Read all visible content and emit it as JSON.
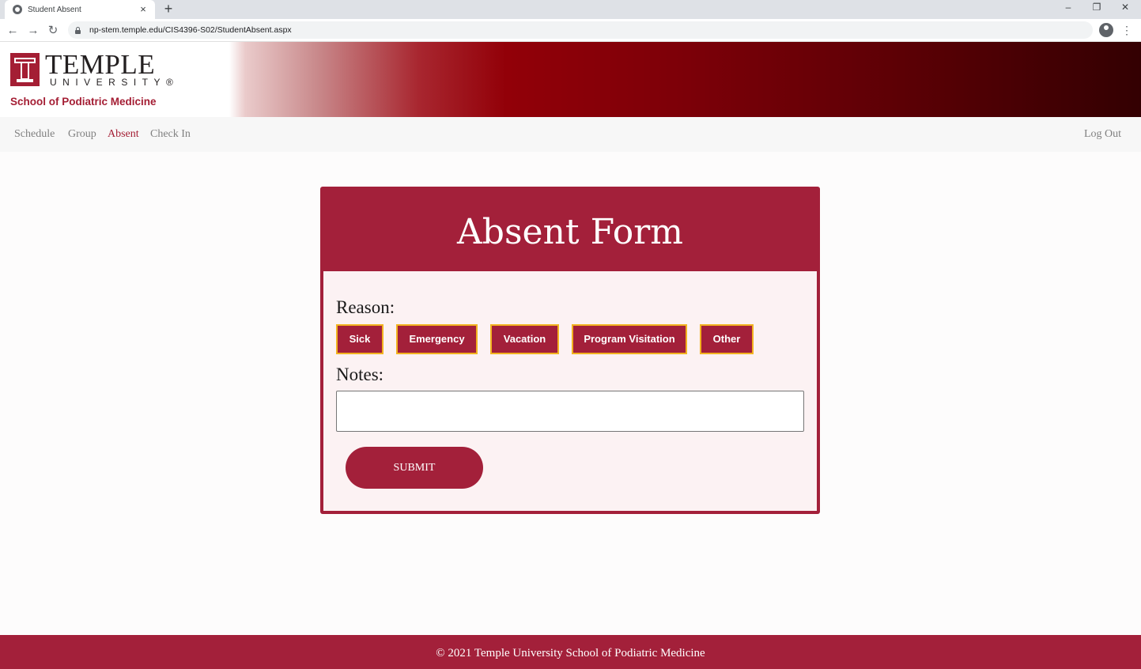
{
  "browser": {
    "tab_title": "Student Absent",
    "tab_close": "×",
    "new_tab": "+",
    "url": "np-stem.temple.edu/CIS4396-S02/StudentAbsent.aspx",
    "window_controls": {
      "minimize": "–",
      "restore": "❐",
      "close": "✕"
    },
    "nav": {
      "back": "←",
      "forward": "→",
      "reload": "↻"
    },
    "menu": "⋮"
  },
  "header": {
    "logo_word": "TEMPLE",
    "logo_sub": "UNIVERSITY®",
    "school_name": "School of Podiatric Medicine"
  },
  "nav": {
    "items": [
      {
        "label": "Schedule",
        "active": false
      },
      {
        "label": "Group",
        "active": false
      },
      {
        "label": "Absent",
        "active": true
      },
      {
        "label": "Check In",
        "active": false
      }
    ],
    "logout": "Log Out"
  },
  "form": {
    "title": "Absent Form",
    "reason_label": "Reason:",
    "reasons": [
      "Sick",
      "Emergency",
      "Vacation",
      "Program Visitation",
      "Other"
    ],
    "notes_label": "Notes:",
    "notes_value": "",
    "notes_placeholder": "",
    "submit_label": "SUBMIT"
  },
  "footer": {
    "text": "© 2021 Temple University School of Podiatric Medicine"
  },
  "colors": {
    "brand": "#a41e34",
    "button_border": "#f2b320",
    "form_bg": "#fcf2f3"
  }
}
